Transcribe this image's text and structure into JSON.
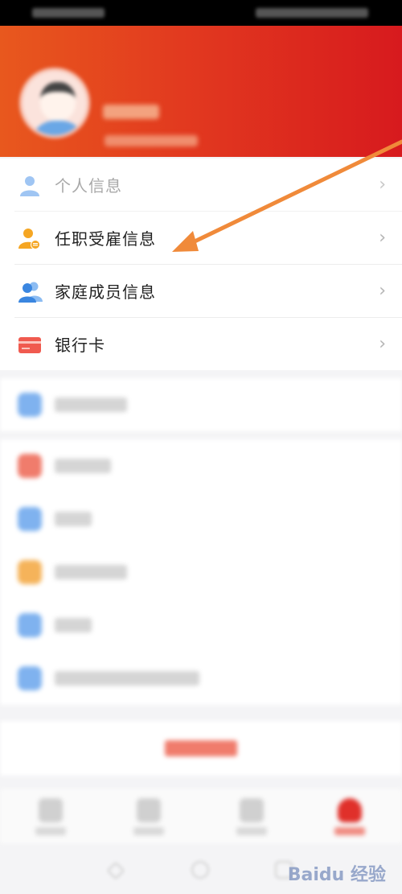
{
  "profile_menu": {
    "items": [
      {
        "label": "个人信息",
        "icon": "person-icon"
      },
      {
        "label": "任职受雇信息",
        "icon": "employee-badge-icon"
      },
      {
        "label": "家庭成员信息",
        "icon": "family-icon"
      },
      {
        "label": "银行卡",
        "icon": "bank-card-icon"
      }
    ],
    "chevron": "›"
  },
  "watermark": "Baidu 经验",
  "colors": {
    "header_start": "#e8581e",
    "header_end": "#d71a1e",
    "arrow": "#f08a3a",
    "icon_orange": "#f5a623",
    "icon_blue": "#4a90e2",
    "icon_red": "#f05a4f"
  }
}
